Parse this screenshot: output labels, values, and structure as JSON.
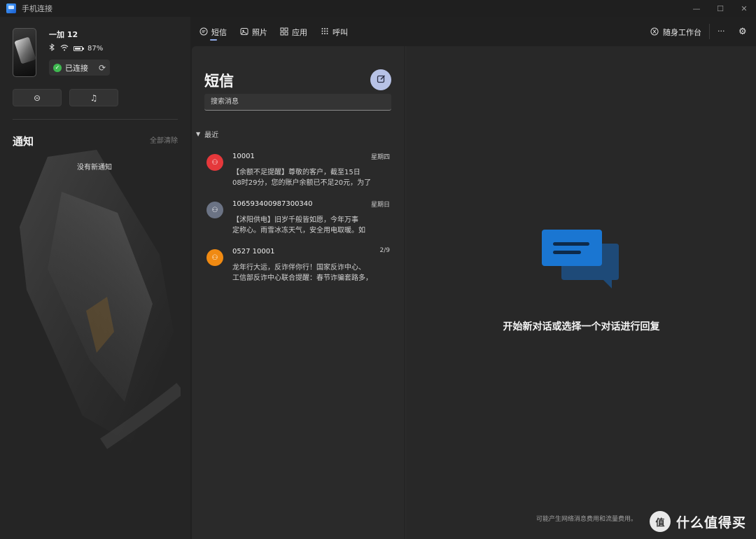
{
  "window": {
    "title": "手机连接",
    "controls": [
      "—",
      "☐",
      "✕"
    ]
  },
  "device": {
    "name": "一加 12",
    "battery": "87%",
    "status": "已连接"
  },
  "left": {
    "dnd_icon": "⊝",
    "music_icon": "♫",
    "notifications_title": "通知",
    "clear_all": "全部清除",
    "empty": "没有新通知"
  },
  "nav": {
    "tabs": [
      {
        "label": "短信",
        "icon": "message-icon"
      },
      {
        "label": "照片",
        "icon": "photo-icon"
      },
      {
        "label": "应用",
        "icon": "apps-icon"
      },
      {
        "label": "呼叫",
        "icon": "dialpad-icon"
      }
    ],
    "workspace": "随身工作台",
    "more": "···",
    "settings": "⚙"
  },
  "messages": {
    "title": "短信",
    "search_placeholder": "搜索消息",
    "section": "最近",
    "conversations": [
      {
        "name": "10001",
        "date": "星期四",
        "line1": "【余额不足提醒】尊敬的客户，截至15日",
        "line2": "08时29分，您的账户余额已不足20元，为了",
        "color": "#e5383b"
      },
      {
        "name": "106593400987300340",
        "date": "星期日",
        "line1": "【沭阳供电】旧岁千般皆如愿，今年万事",
        "line2": "定称心。雨雪冰冻天气，安全用电取暖。如",
        "color": "#6b7384"
      },
      {
        "name": "0527 10001",
        "date": "2/9",
        "line1": "龙年行大运，反诈伴你行！国家反诈中心、",
        "line2": "工信部反诈中心联合提醒：春节诈骗套路多，",
        "color": "#f08a12"
      }
    ]
  },
  "detail": {
    "empty_text": "开始新对话或选择一个对话进行回复",
    "footer_note": "可能产生网络消息费用和流量费用。"
  },
  "watermark": {
    "logo": "值",
    "text": "什么值得买"
  },
  "colors": {
    "accent": "#8fa9e6",
    "bubble_front": "#1a76d2",
    "bubble_back": "#1e4a78"
  }
}
